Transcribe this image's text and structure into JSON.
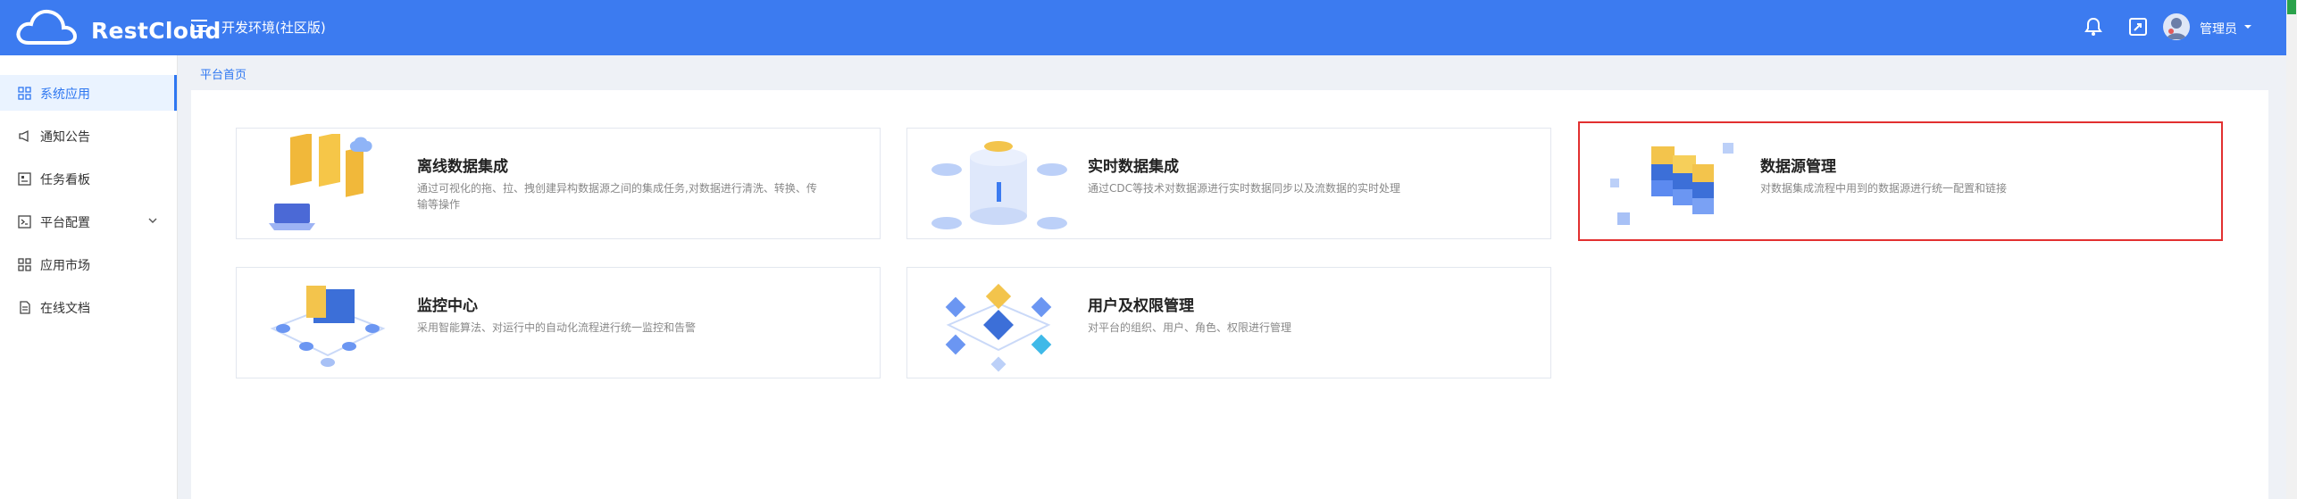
{
  "app": {
    "brand": "RestCloud",
    "environment": "开发环境(社区版)"
  },
  "header": {
    "user_name": "管理员"
  },
  "sidebar": {
    "items": [
      {
        "label": "系统应用",
        "active": true
      },
      {
        "label": "通知公告"
      },
      {
        "label": "任务看板"
      },
      {
        "label": "平台配置"
      },
      {
        "label": "应用市场"
      },
      {
        "label": "在线文档"
      }
    ]
  },
  "breadcrumb": "平台首页",
  "cards": [
    {
      "title": "离线数据集成",
      "description": "通过可视化的拖、拉、拽创建异构数据源之间的集成任务,对数据进行清洗、转换、传输等操作"
    },
    {
      "title": "实时数据集成",
      "description": "通过CDC等技术对数据源进行实时数据同步以及流数据的实时处理"
    },
    {
      "title": "数据源管理",
      "description": "对数据集成流程中用到的数据源进行统一配置和链接"
    },
    {
      "title": "监控中心",
      "description": "采用智能算法、对运行中的自动化流程进行统一监控和告警"
    },
    {
      "title": "用户及权限管理",
      "description": "对平台的组织、用户、角色、权限进行管理"
    }
  ],
  "colors": {
    "header_bg": "#3c7bf0",
    "accent": "#2e77f1",
    "selected_outline": "#e23030"
  }
}
